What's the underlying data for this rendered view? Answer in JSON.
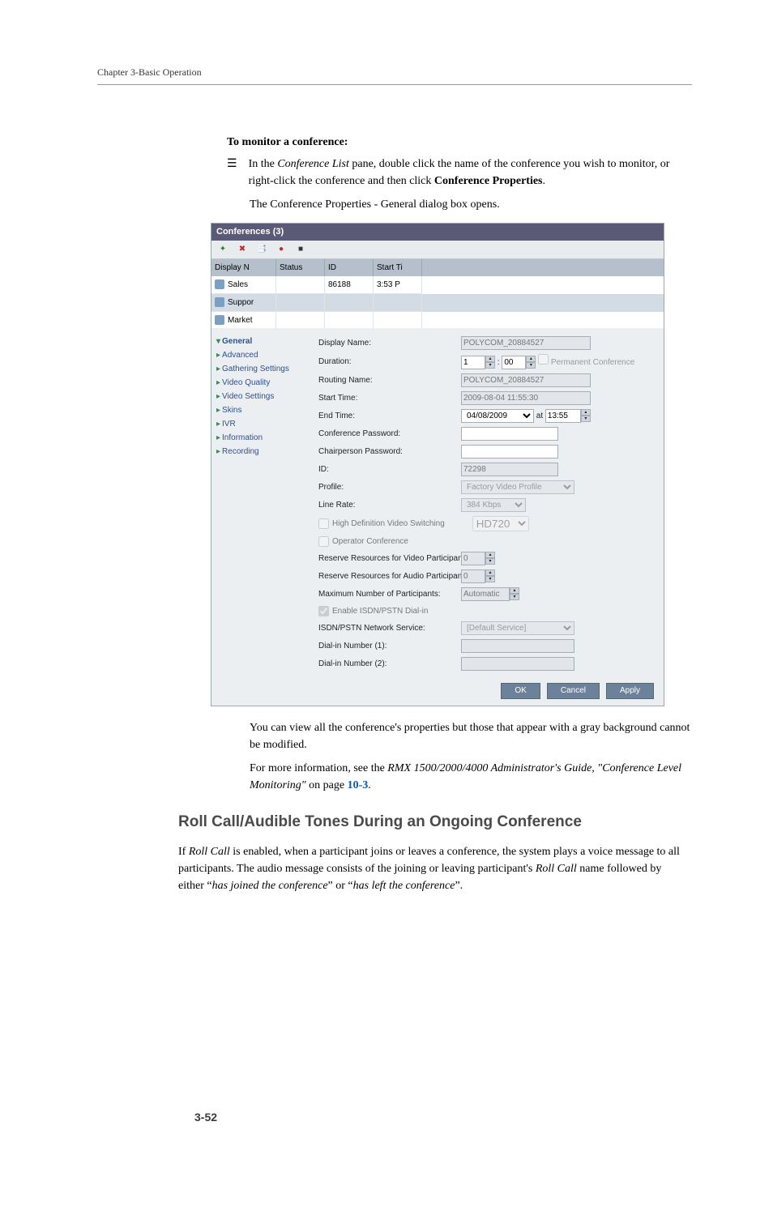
{
  "header": {
    "chapter": "Chapter 3-Basic Operation"
  },
  "procedure": {
    "title": "To monitor a conference:",
    "step1_a": "In the ",
    "step1_b": "Conference List",
    "step1_c": " pane, double click the name of the conference you wish to monitor, or right-click the conference and then click ",
    "step1_d": "Conference Properties",
    "step1_e": ".",
    "follow_a": "The ",
    "follow_b": "Conference Properties",
    "follow_c": " - ",
    "follow_d": "General",
    "follow_e": " dialog box opens."
  },
  "screenshot": {
    "listTitle": "Conferences (3)",
    "columns": [
      "Display N",
      "Status",
      "ID",
      "Start Ti"
    ],
    "rows": [
      {
        "name": "Sales",
        "status": "",
        "id": "86188",
        "start": "3:53 P"
      },
      {
        "name": "Suppor",
        "status": "",
        "id": "",
        "start": ""
      },
      {
        "name": "Market",
        "status": "",
        "id": "",
        "start": ""
      }
    ],
    "tree": [
      "General",
      "Advanced",
      "Gathering Settings",
      "Video Quality",
      "Video Settings",
      "Skins",
      "IVR",
      "Information",
      "Recording"
    ],
    "fields": {
      "displayName": {
        "label": "Display Name:",
        "value": "POLYCOM_20884527"
      },
      "duration": {
        "label": "Duration:",
        "h": "1",
        "m": "00",
        "perm": "Permanent Conference"
      },
      "routing": {
        "label": "Routing Name:",
        "value": "POLYCOM_20884527"
      },
      "start": {
        "label": "Start Time:",
        "value": "2009-08-04 11:55:30"
      },
      "end": {
        "label": "End Time:",
        "date": "04/08/2009",
        "at": "at",
        "time": "13:55"
      },
      "confPw": {
        "label": "Conference Password:",
        "value": ""
      },
      "chairPw": {
        "label": "Chairperson Password:",
        "value": ""
      },
      "id": {
        "label": "ID:",
        "value": "72298"
      },
      "profile": {
        "label": "Profile:",
        "value": "Factory Video Profile"
      },
      "lineRate": {
        "label": "Line Rate:",
        "value": "384 Kbps"
      },
      "hd": {
        "label": "High Definition Video Switching",
        "res": "HD720"
      },
      "opConf": {
        "label": "Operator Conference"
      },
      "resVideo": {
        "label": "Reserve Resources for Video Participants:",
        "value": "0"
      },
      "resAudio": {
        "label": "Reserve Resources for Audio Participants:",
        "value": "0"
      },
      "maxPart": {
        "label": "Maximum Number of Participants:",
        "value": "Automatic"
      },
      "enableIsdn": {
        "label": "Enable ISDN/PSTN Dial-in"
      },
      "isdnSvc": {
        "label": "ISDN/PSTN Network Service:",
        "value": "[Default Service]"
      },
      "dial1": {
        "label": "Dial-in Number (1):",
        "value": ""
      },
      "dial2": {
        "label": "Dial-in Number (2):",
        "value": ""
      }
    },
    "buttons": {
      "ok": "OK",
      "cancel": "Cancel",
      "apply": "Apply"
    }
  },
  "after": {
    "p1": "You can view all the conference's properties but those that appear with a gray background cannot be modified.",
    "p2_a": "For more information",
    "p2_b": ",",
    "p2_c": " see the ",
    "p2_d": "RMX 1500/2000/4000 Administrator's Guide, \"Conference Level Monitoring\"",
    "p2_e": " on page ",
    "p2_link": "10-3",
    "p2_f": "."
  },
  "section": {
    "heading": "Roll Call/Audible Tones During an Ongoing Conference",
    "p_a": "If ",
    "p_b": "Roll Call",
    "p_c": " is enabled, when a participant joins or leaves a conference, the system plays a voice message to all participants. The audio message consists of the joining or leaving participant's ",
    "p_d": "Roll Call",
    "p_e": " name followed by either “",
    "p_f": "has joined the conference",
    "p_g": "” or “",
    "p_h": "has left the conference",
    "p_i": "”."
  },
  "pageNumber": "3-52",
  "icons": {
    "listBullet": "☰"
  }
}
